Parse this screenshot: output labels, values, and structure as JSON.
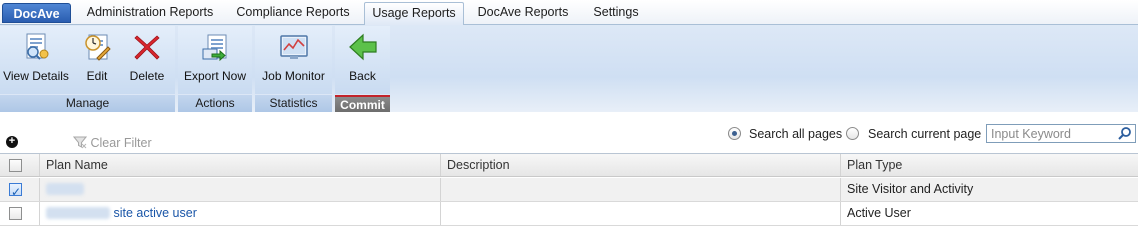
{
  "tabs": [
    {
      "label": "DocAve"
    },
    {
      "label": "Administration Reports"
    },
    {
      "label": "Compliance Reports"
    },
    {
      "label": "Usage Reports"
    },
    {
      "label": "DocAve Reports"
    },
    {
      "label": "Settings"
    }
  ],
  "active_tab": "Usage Reports",
  "ribbon": {
    "manage": {
      "label": "Manage",
      "buttons": [
        {
          "label": "View Details",
          "icon": "view-details-icon"
        },
        {
          "label": "Edit",
          "icon": "edit-icon"
        },
        {
          "label": "Delete",
          "icon": "delete-x-icon"
        }
      ]
    },
    "actions": {
      "label": "Actions",
      "buttons": [
        {
          "label": "Export Now",
          "icon": "export-icon"
        }
      ]
    },
    "statistics": {
      "label": "Statistics",
      "buttons": [
        {
          "label": "Job Monitor",
          "icon": "job-monitor-icon"
        }
      ]
    },
    "commit": {
      "label": "Commit",
      "buttons": [
        {
          "label": "Back",
          "icon": "back-arrow-icon"
        }
      ]
    }
  },
  "toolbar": {
    "clear_filter": "Clear Filter",
    "search_all_pages": "Search all pages",
    "search_current_page": "Search current page",
    "search_all_selected": true,
    "search_placeholder": "Input Keyword"
  },
  "grid": {
    "columns": [
      "Plan Name",
      "Description",
      "Plan Type"
    ],
    "rows": [
      {
        "plan_name": "",
        "description": "",
        "plan_type": "Site Visitor and Activity",
        "checked": true
      },
      {
        "plan_name": "site active user",
        "description": "",
        "plan_type": "Active User",
        "checked": false
      }
    ]
  },
  "colors": {
    "home_tab": "#2a5db0",
    "link": "#1a56a8",
    "commit_bar": "#c3232b"
  }
}
